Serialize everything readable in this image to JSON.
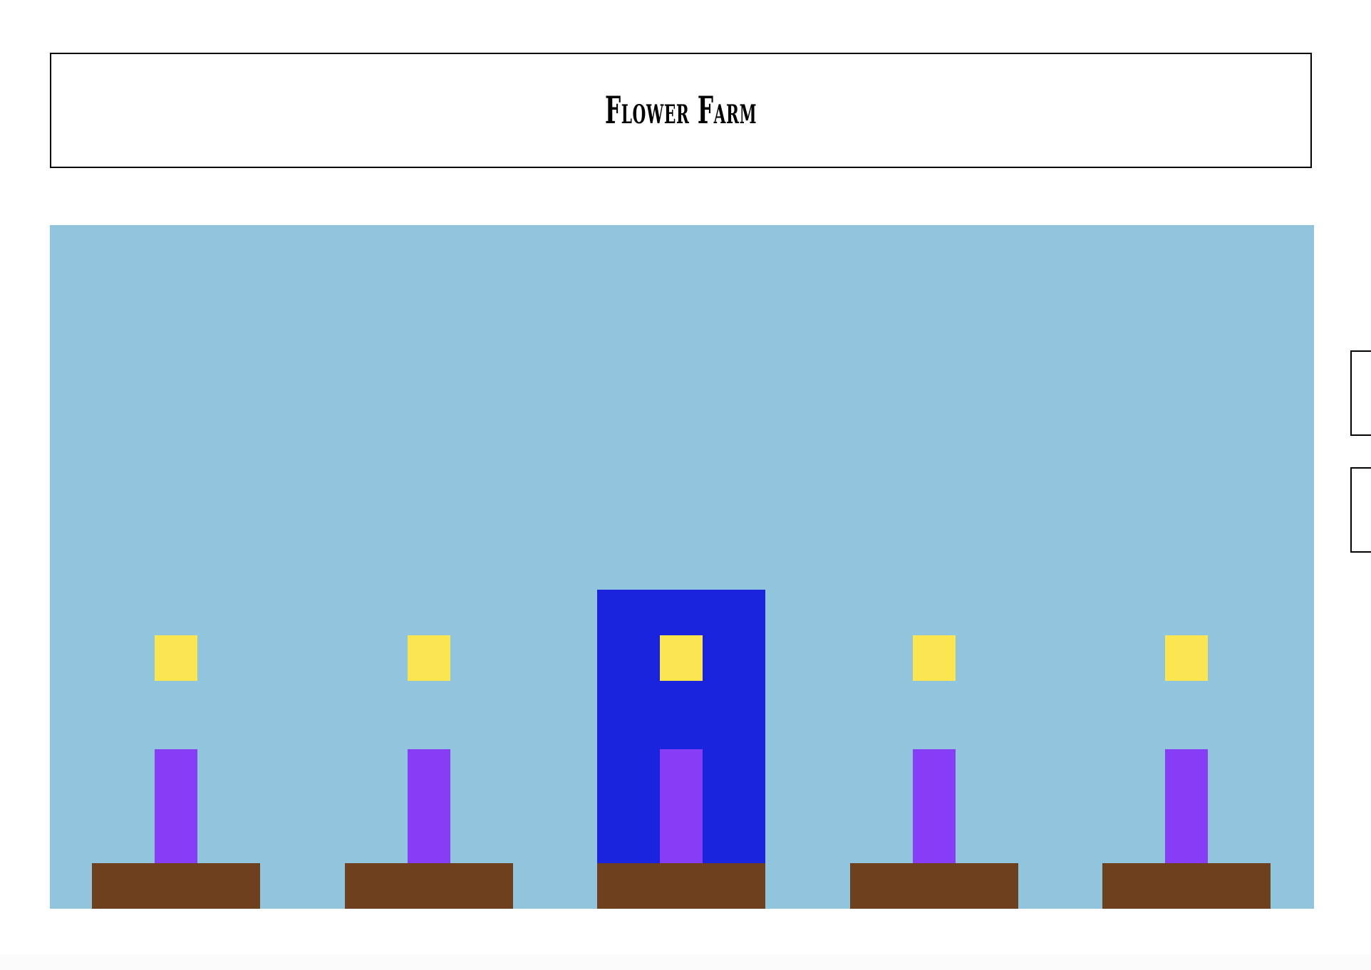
{
  "header": {
    "title": "Flower Farm"
  },
  "colors": {
    "sky": "#91c5de",
    "soil": "#6e401d",
    "stem": "#873cf6",
    "flower_head": "#fbe551",
    "selected_plot": "#1a24dc",
    "border": "#000000"
  },
  "game": {
    "selected_plot": 2,
    "plots": [
      {
        "id": "plot-1",
        "has_flower": true
      },
      {
        "id": "plot-2",
        "has_flower": true
      },
      {
        "id": "plot-3",
        "has_flower": true
      },
      {
        "id": "plot-4",
        "has_flower": true
      },
      {
        "id": "plot-5",
        "has_flower": true
      }
    ]
  },
  "side_panel": {
    "buttons": [
      "",
      ""
    ]
  }
}
